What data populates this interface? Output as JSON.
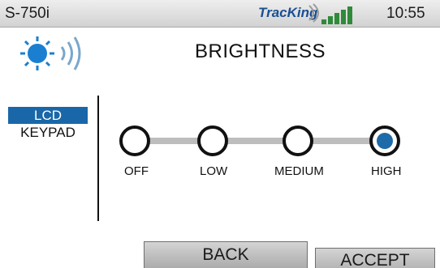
{
  "status_bar": {
    "device": "S-750i",
    "brand": "TracKing",
    "time": "10:55",
    "signal_icon": "signal-bars-icon"
  },
  "header": {
    "title": "BRIGHTNESS",
    "icon": "brightness-icon"
  },
  "menu": {
    "items": [
      {
        "label": "LCD",
        "selected": true
      },
      {
        "label": "KEYPAD",
        "selected": false
      }
    ]
  },
  "brightness": {
    "options": [
      "OFF",
      "LOW",
      "MEDIUM",
      "HIGH"
    ],
    "selected": "HIGH"
  },
  "buttons": {
    "back": "BACK",
    "accept": "ACCEPT"
  },
  "colors": {
    "accent": "#1967a8",
    "brand": "#1a4f92",
    "selected_dot": "#1f6aa8"
  }
}
